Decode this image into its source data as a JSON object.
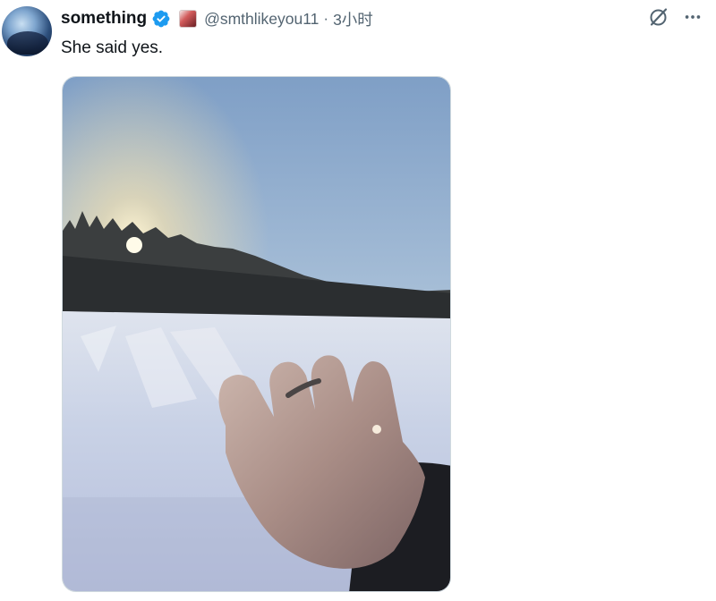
{
  "author": {
    "display_name": "something",
    "handle": "@smthlikeyou11",
    "separator": "·",
    "timestamp": "3小时",
    "verified": true
  },
  "tweet": {
    "text": "She said yes."
  },
  "icons": {
    "grok": "grok-icon",
    "more": "more-options-icon",
    "verified": "verified-badge-icon"
  },
  "colors": {
    "verified_blue": "#1d9bf0",
    "secondary_text": "#536471",
    "primary_text": "#0f1419"
  }
}
